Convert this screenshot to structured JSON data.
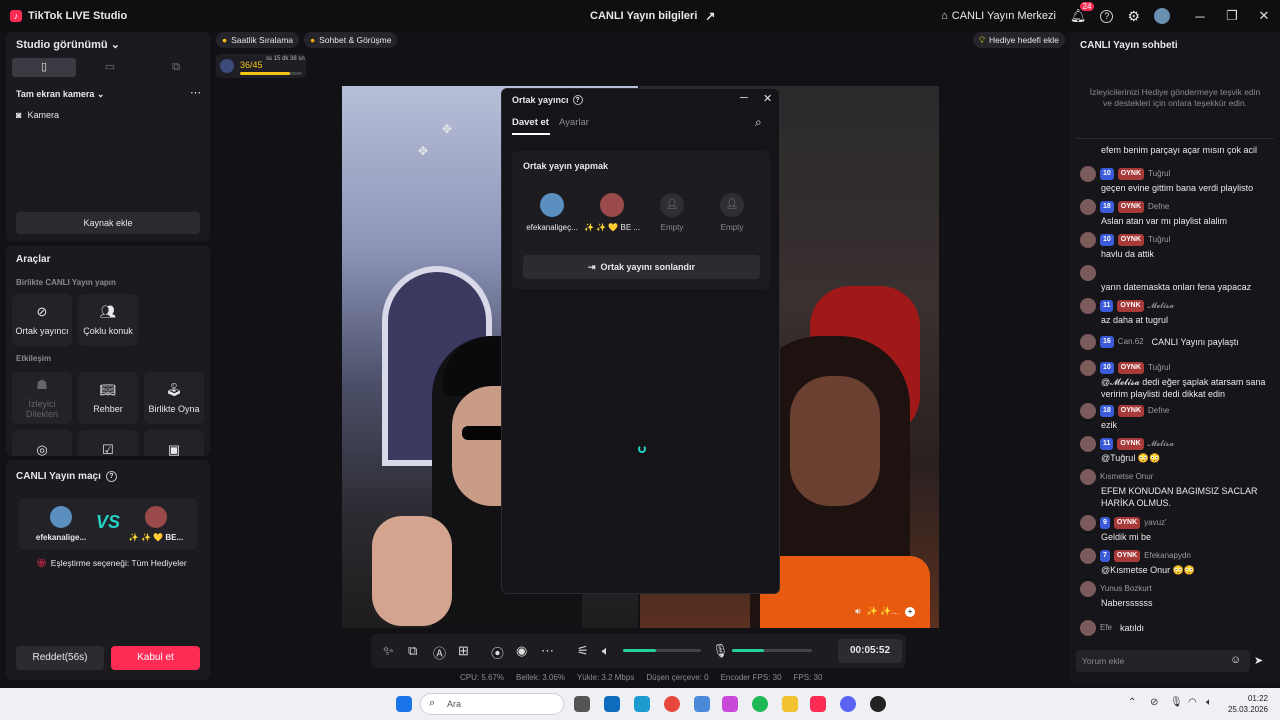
{
  "titlebar": {
    "app_name": "TikTok LIVE Studio",
    "center_title": "CANLI Yayın bilgileri",
    "live_center": "CANLI Yayın Merkezi",
    "notif_count": "24"
  },
  "left": {
    "studio_view": "Studio görünümü",
    "scene_name": "Tam ekran kamera",
    "source_camera": "Kamera",
    "add_source": "Kaynak ekle",
    "tools_title": "Araçlar",
    "collab_title": "Birlikte CANLI Yayın yapın",
    "tool_cohost": "Ortak yayıncı",
    "tool_multiguest": "Çoklu konuk",
    "interaction_title": "Etkileşim",
    "tool_requests_l1": "İzleyici",
    "tool_requests_l2": "Dilekleri",
    "tool_guide": "Rehber",
    "tool_playtogether": "Birlikte Oyna",
    "match_title": "CANLI Yayın maçı",
    "match_p1": "efekanalige...",
    "match_p2": "✨ ✨ 💛 BE...",
    "match_mode": "Eşleştirme seçeneği: Tüm Hediyeler",
    "decline": "Reddet(56s)",
    "accept": "Kabul et"
  },
  "topbar": {
    "hourly": "Saatlik Sıralama",
    "chat_meet": "Sohbet & Görüşme",
    "progress_text": "36/45",
    "progress_time": "ss 15 dk 38 sn",
    "progress_value": 0.8,
    "gift_goal": "Hediye hedefi ekle"
  },
  "modal": {
    "title": "Ortak yayıncı",
    "tab_invite": "Davet et",
    "tab_settings": "Ayarlar",
    "section_title": "Ortak yayın yapmak",
    "slots": [
      "efekanaligeç...",
      "✨ ✨ 💛 BE ...",
      "Empty",
      "Empty"
    ],
    "end_button": "Ortak yayını sonlandır"
  },
  "video": {
    "overlay_label": "✨ ✨..."
  },
  "controls": {
    "timer": "00:05:52",
    "volume": 0.42,
    "mic": 0.4
  },
  "status": {
    "cpu": "CPU: 5.67%",
    "memory": "Bellek: 3.06%",
    "upload": "Yükle: 3.2 Mbps",
    "dropped": "Düşen çerçeve: 0",
    "encoder_fps": "Encoder FPS: 30",
    "fps": "FPS: 30"
  },
  "chat": {
    "title": "CANLI Yayın sohbeti",
    "notice": "İzleyicilerinizi Hediye göndermeye teşvik edin ve destekleri için onlara teşekkür edin.",
    "first_line": "efem benim parçayı açar mısın çok acil",
    "messages": [
      {
        "lvl": "10",
        "tag": "OYNK",
        "user": "Tuğrul",
        "text": "geçen evine gittim bana verdi playlisto"
      },
      {
        "lvl": "18",
        "tag": "OYNK",
        "user": "Defne",
        "text": "Aslan atan var mı playlist alalim"
      },
      {
        "lvl": "10",
        "tag": "OYNK",
        "user": "Tuğrul",
        "text": "havlu da attik"
      },
      {
        "lvl": "",
        "tag": "",
        "user": "",
        "text": "yarın datemaskta onları fena yapacaz"
      },
      {
        "lvl": "11",
        "tag": "OYNK",
        "user": "𝓜𝓮𝓵𝓲𝓼𝓪",
        "text": "az daha at tugrul"
      },
      {
        "lvl": "16",
        "tag": "",
        "user": "Can.62",
        "text": "CANLI Yayını paylaştı"
      },
      {
        "lvl": "10",
        "tag": "OYNK",
        "user": "Tuğrul",
        "text": "@𝓜𝓮𝓵𝓲𝓼𝓪 dedi eğer şaplak atarsam sana veririm playlisti dedi dikkat edin"
      },
      {
        "lvl": "18",
        "tag": "OYNK",
        "user": "Defne",
        "text": "ezik"
      },
      {
        "lvl": "11",
        "tag": "OYNK",
        "user": "𝓜𝓮𝓵𝓲𝓼𝓪",
        "text": "@Tuğrul 😳😳"
      },
      {
        "lvl": "",
        "tag": "",
        "user": "Kısmetse Onur",
        "text": "EFEM KONUDAN BAGIMSIZ SACLAR HARİKA OLMUS."
      },
      {
        "lvl": "9",
        "tag": "OYNK",
        "user": "yavuz'",
        "text": "Geldik mi be"
      },
      {
        "lvl": "7",
        "tag": "OYNK",
        "user": "Efekanapydn",
        "text": "@Kısmetse Onur 😳😳"
      },
      {
        "lvl": "",
        "tag": "",
        "user": "Yunus Bozkurt",
        "text": "Naberssssss"
      },
      {
        "lvl": "",
        "tag": "",
        "user": "Efe",
        "text": "katıldı"
      }
    ],
    "input_placeholder": "Yorum ekle"
  },
  "taskbar": {
    "search": "Ara",
    "time": "01:22",
    "date": "25.03.2026"
  }
}
